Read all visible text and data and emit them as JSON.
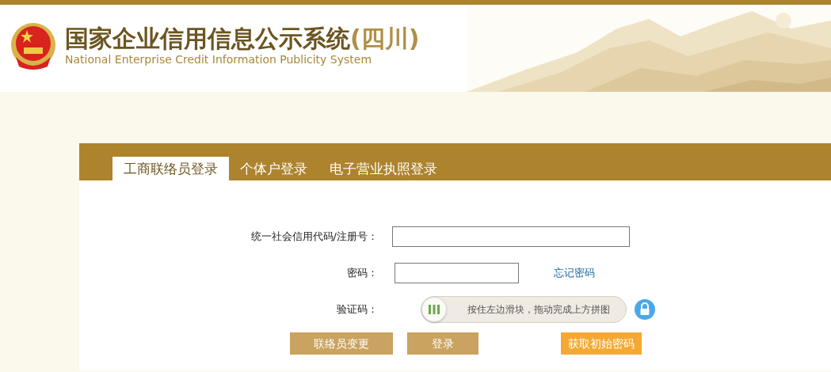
{
  "header": {
    "title": "国家企业信用信息公示系统",
    "region": "(四川)",
    "subtitle": "National Enterprise Credit Information Publicity System"
  },
  "tabs": [
    {
      "label": "工商联络员登录",
      "selected": true
    },
    {
      "label": "个体户登录",
      "selected": false
    },
    {
      "label": "电子营业执照登录",
      "selected": false
    }
  ],
  "form": {
    "code_label": "统一社会信用代码/注册号：",
    "password_label": "密码：",
    "forgot_link": "忘记密码",
    "captcha_label": "验证码：",
    "slider": {
      "hint": "按住左边滑块，拖动完成上方拼图",
      "level": 0
    }
  },
  "buttons": [
    {
      "label": "联络员变更",
      "kind": "normal"
    },
    {
      "label": "登录",
      "kind": "normal"
    },
    {
      "label": "获取初始密码",
      "kind": "accent"
    }
  ]
}
